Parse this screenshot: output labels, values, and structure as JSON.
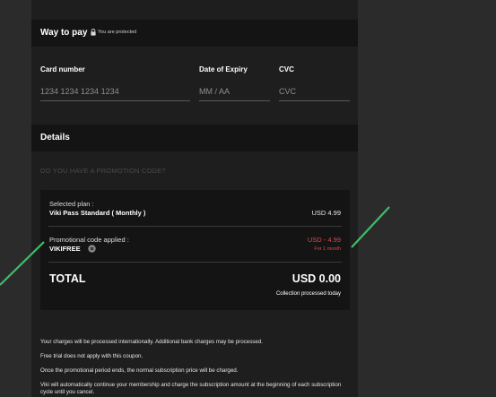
{
  "payment": {
    "section_title": "Way to pay",
    "protected_note": "You are protected",
    "card_number_label": "Card number",
    "card_number_placeholder": "1234 1234 1234 1234",
    "expiry_label": "Date of Expiry",
    "expiry_placeholder": "MM / AA",
    "cvc_label": "CVC",
    "cvc_placeholder": "CVC"
  },
  "details": {
    "section_title": "Details",
    "promo_link": "DO YOU HAVE A PROMOTION CODE?",
    "selected_plan_label": "Selected plan :",
    "selected_plan_name": "Viki Pass Standard ( Monthly )",
    "plan_price": "USD 4.99",
    "promo_applied_label": "Promotional code applied :",
    "promo_code": "VIKIFREE",
    "promo_discount": "USD - 4.99",
    "promo_duration": "For 1 month",
    "total_label": "TOTAL",
    "total_value": "USD 0.00",
    "collection_note": "Collection processed today"
  },
  "notes": [
    "Your charges will be processed internationally. Additional bank charges may be processed.",
    "Free trial does not apply with this coupon.",
    "Once the promotional period ends, the normal subscription price will be charged.",
    "Viki will automatically continue your membership and charge the subscription amount at the beginning of each subscription cycle until you cancel."
  ],
  "colors": {
    "page_background": "#2b2b2b",
    "panel_background": "#1e1e1e",
    "header_background": "#141414",
    "discount_red": "#e04848",
    "annotation_green": "#3fbf6a"
  },
  "icons": {
    "lock": "lock-icon",
    "remove_coupon": "close-circle-icon"
  }
}
